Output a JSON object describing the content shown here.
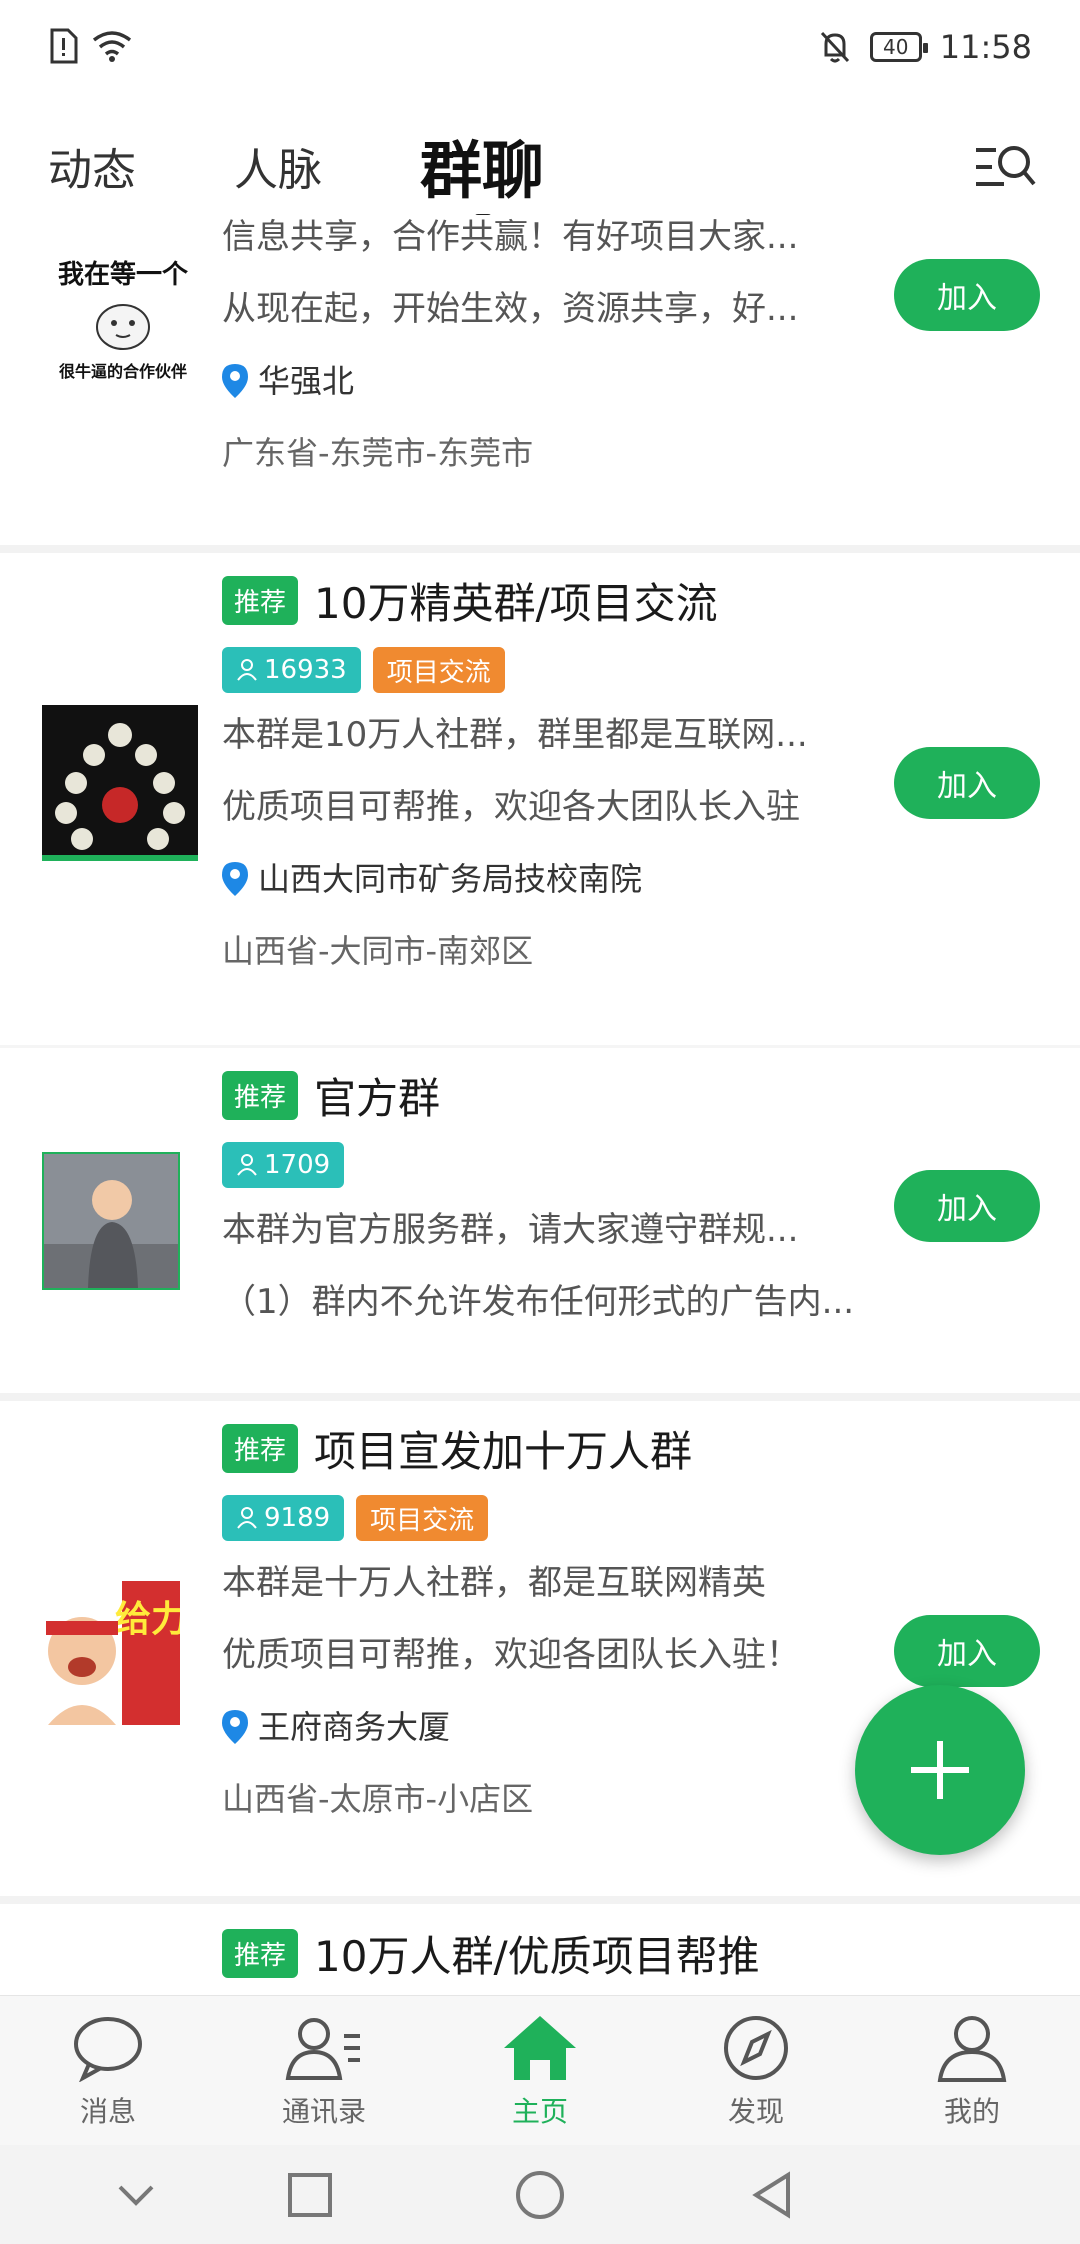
{
  "status_bar": {
    "time": "11:58",
    "battery": "40"
  },
  "top_tabs": {
    "tab1": "动态",
    "tab2": "人脉",
    "active": "群聊"
  },
  "groups": [
    {
      "desc1": "信息共享，合作共赢！有好项目大家...",
      "desc2": "从现在起，开始生效，资源共享，好...",
      "location": "华强北",
      "region": "广东省-东莞市-东莞市",
      "join": "加入",
      "avatar_lines": [
        "我在等一个",
        "很牛逼的合作伙伴"
      ]
    },
    {
      "badge": "推荐",
      "title": "10万精英群/项目交流",
      "members": "16933",
      "category": "项目交流",
      "desc1": "本群是10万人社群，群里都是互联网...",
      "desc2": "优质项目可帮推，欢迎各大团队长入驻",
      "location": "山西大同市矿务局技校南院",
      "region": "山西省-大同市-南郊区",
      "join": "加入"
    },
    {
      "badge": "推荐",
      "title": "官方群",
      "members": "1709",
      "desc1": "本群为官方服务群，请大家遵守群规...",
      "desc2": "（1）群内不允许发布任何形式的广告内...",
      "join": "加入"
    },
    {
      "badge": "推荐",
      "title": "项目宣发加十万人群",
      "members": "9189",
      "category": "项目交流",
      "desc1": "本群是十万人社群，都是互联网精英",
      "desc2": "优质项目可帮推，欢迎各团队长入驻！",
      "location": "王府商务大厦",
      "region": "山西省-太原市-小店区",
      "join": "加入",
      "avatar_text": "给力"
    },
    {
      "badge": "推荐",
      "title": "10万人群/优质项目帮推"
    }
  ],
  "bottom_nav": [
    {
      "label": "消息",
      "icon": "chat-bubble-icon"
    },
    {
      "label": "通讯录",
      "icon": "contacts-icon"
    },
    {
      "label": "主页",
      "icon": "home-icon",
      "active": true
    },
    {
      "label": "发现",
      "icon": "compass-icon"
    },
    {
      "label": "我的",
      "icon": "profile-icon"
    }
  ],
  "colors": {
    "accent": "#1fb15a",
    "member_tag": "#2bbfb8",
    "category_tag": "#f08a30"
  }
}
